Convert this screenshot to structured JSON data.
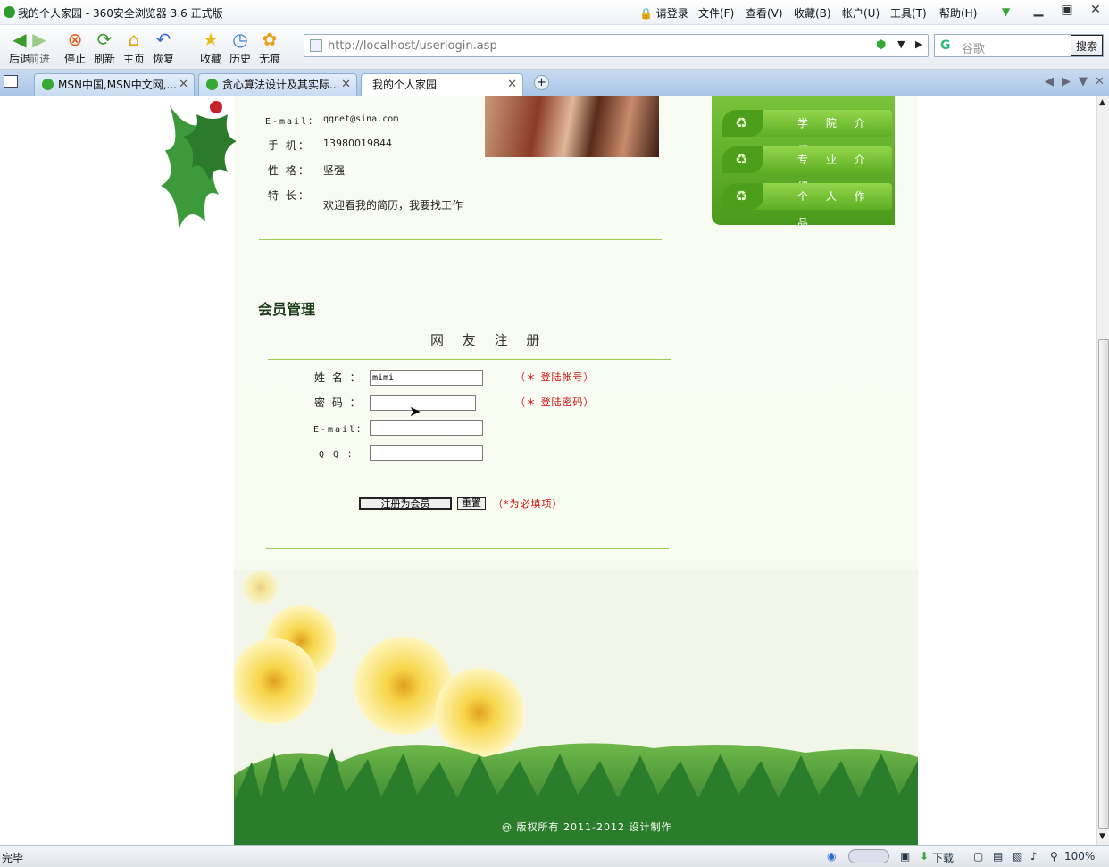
{
  "browser": {
    "window_title": "我的个人家园 - 360安全浏览器 3.6 正式版",
    "login": "请登录",
    "menus": [
      "文件(F)",
      "查看(V)",
      "收藏(B)",
      "帐户(U)",
      "工具(T)",
      "帮助(H)"
    ],
    "toolbar": {
      "back": "后退",
      "forward": "前进",
      "stop": "停止",
      "refresh": "刷新",
      "home": "主页",
      "restore": "恢复",
      "favorites": "收藏",
      "history": "历史",
      "private": "无痕"
    },
    "address": "http://localhost/userlogin.asp",
    "search": {
      "engine": "谷歌",
      "button": "搜索"
    },
    "tabs": [
      {
        "label": "MSN中国,MSN中文网,..."
      },
      {
        "label": "贪心算法设计及其实际..."
      },
      {
        "label": "我的个人家园"
      }
    ],
    "status": {
      "text": "完毕",
      "download": "下载",
      "zoom": "100%"
    }
  },
  "profile": {
    "email_label": "E-mail：",
    "email": "qqnet@sina.com",
    "phone_label": "手 机：",
    "phone": "13980019844",
    "character_label": "性 格：",
    "character": "坚强",
    "specialty_label": "特 长：",
    "specialty": "欢迎看我的简历，我要找工作"
  },
  "nav": [
    "学 院 介 绍",
    "专 业 介 绍",
    "个 人 作 品"
  ],
  "member": {
    "section_title": "会员管理",
    "form_title": "网 友 注 册",
    "name_label": "姓 名 ：",
    "name_value": "mimi",
    "name_hint": "（＊ 登陆帐号）",
    "password_label": "密 码 ：",
    "password_hint": "（＊ 登陆密码）",
    "email_label": "E-mail：",
    "qq_label": "Q Q ：",
    "submit": "注册为会员",
    "reset": "重置",
    "required_note": "（*为必填项）"
  },
  "footer": {
    "copyright": "@ 版权所有 2011-2012 设计制作"
  },
  "colors": {
    "accent_green": "#6cbd2c",
    "required_red": "#cc1010",
    "tab_blue": "#a9c6e6"
  }
}
